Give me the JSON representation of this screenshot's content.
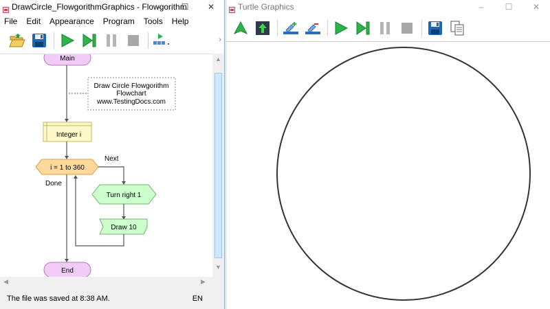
{
  "flowgorithm_window": {
    "title": "DrawCircle_FlowgorithmGraphics - Flowgorithm",
    "buttons": {
      "minimize": "–",
      "maximize": "☐",
      "close": "✕"
    },
    "menu": [
      "File",
      "Edit",
      "Appearance",
      "Program",
      "Tools",
      "Help"
    ],
    "toolbar": {
      "icons": [
        "open-folder-icon",
        "save-icon",
        "run-icon",
        "step-icon",
        "pause-icon",
        "stop-icon",
        "variable-watch-icon"
      ],
      "more": "›"
    },
    "flowchart": {
      "main_label": "Main",
      "comment_lines": [
        "Draw Circle Flowgorithm",
        "Flowchart",
        "www.TestingDocs.com"
      ],
      "declare_label": "Integer i",
      "loop_label": "i = 1 to 360",
      "next_label": "Next",
      "done_label": "Done",
      "turn_label": "Turn right 1",
      "draw_label": "Draw 10",
      "end_label": "End"
    },
    "scroll": {
      "up": "▲",
      "down": "▼",
      "left": "◀",
      "right": "▶"
    },
    "status": {
      "message": "The file was saved at 8:38 AM.",
      "language": "EN"
    }
  },
  "turtle_window": {
    "title": "Turtle Graphics",
    "buttons": {
      "minimize": "–",
      "maximize": "☐",
      "close": "✕"
    },
    "toolbar": {
      "icons": [
        "turtle-icon",
        "home-icon",
        "pen-down-icon",
        "pen-up-icon",
        "run-icon",
        "step-icon",
        "pause-icon",
        "stop-icon",
        "save-icon",
        "copy-icon"
      ]
    }
  },
  "colors": {
    "run_green": "#2db34a",
    "pause_gray": "#b5b5b5",
    "terminal_fill": "#f2ccf7",
    "declare_fill": "#fff8c8",
    "loop_fill": "#ffd99c",
    "turtle_fill": "#ccffcc"
  }
}
